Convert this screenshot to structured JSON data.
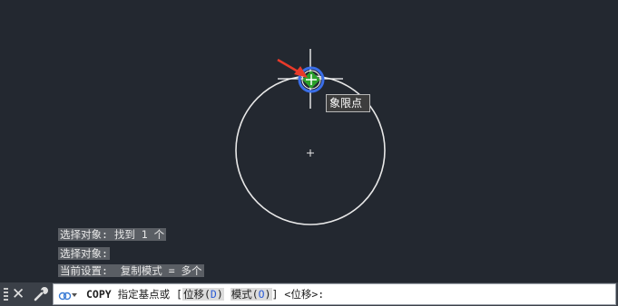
{
  "colors": {
    "background": "#232830",
    "geometry": "#e8e8e8",
    "crosshair": "#ffffff",
    "snap_marker": "#2aa02a",
    "snap_halo": "#3a6ee8",
    "arrow": "#e83a2a"
  },
  "canvas": {
    "tooltip_label": "象限点"
  },
  "history": [
    "选择对象: 找到 1 个",
    "选择对象:",
    "当前设置:  复制模式 = 多个"
  ],
  "command_line": {
    "command_name": "COPY",
    "prompt_text": " 指定基点或 [",
    "option1_text": "位移(",
    "option1_key": "D",
    "option1_close": ")",
    "option2_text": "模式(",
    "option2_key": "O",
    "option2_close": ")",
    "prompt_end": "] <位移>:",
    "icons": [
      "grip-icon",
      "close-icon",
      "wrench-icon",
      "command-history-icon"
    ]
  }
}
